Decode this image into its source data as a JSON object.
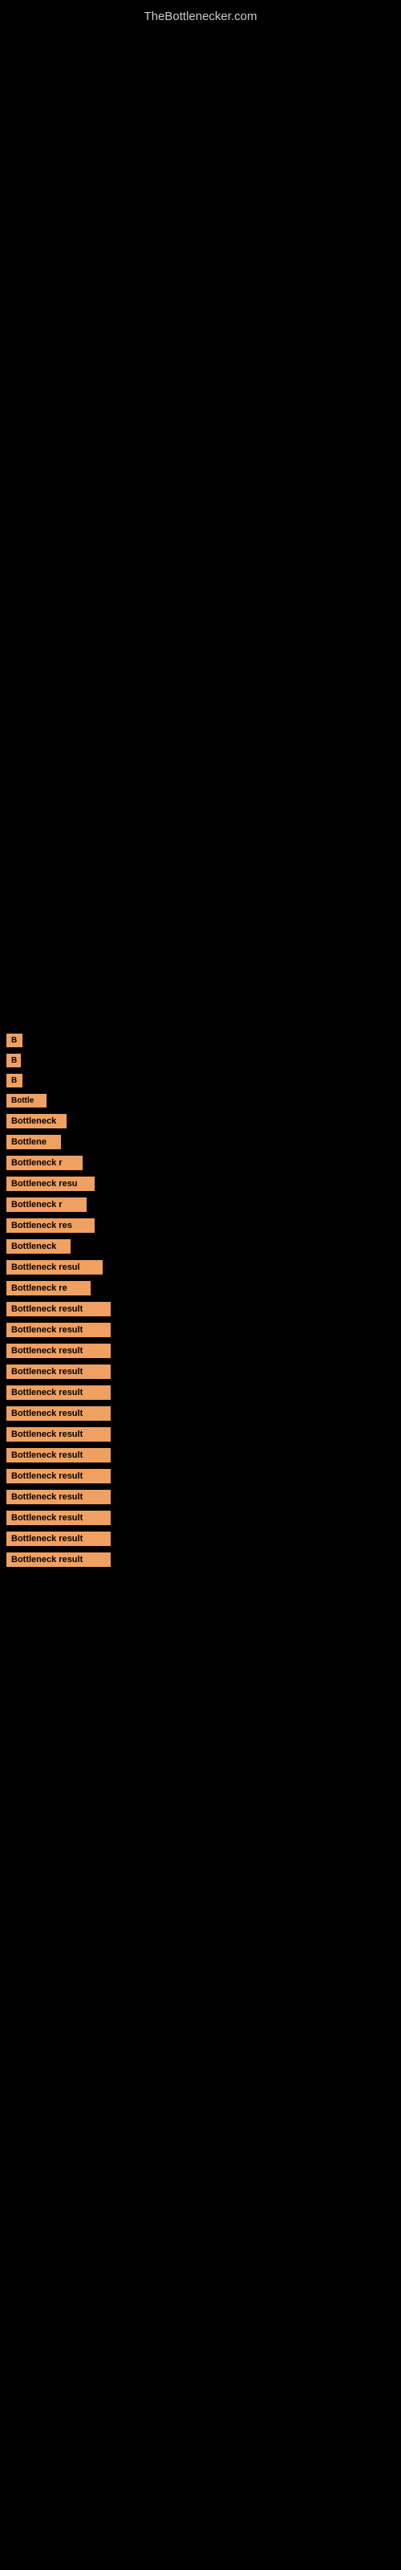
{
  "site": {
    "title": "TheBottlenecker.com"
  },
  "results": [
    {
      "id": 1,
      "label": "B",
      "full_text": "B"
    },
    {
      "id": 2,
      "label": "B",
      "full_text": "B"
    },
    {
      "id": 3,
      "label": "B",
      "full_text": "B"
    },
    {
      "id": 4,
      "label": "Bottle",
      "full_text": "Bottle"
    },
    {
      "id": 5,
      "label": "Bottleneck",
      "full_text": "Bottleneck"
    },
    {
      "id": 6,
      "label": "Bottlene",
      "full_text": "Bottlene"
    },
    {
      "id": 7,
      "label": "Bottleneck r",
      "full_text": "Bottleneck r"
    },
    {
      "id": 8,
      "label": "Bottleneck resu",
      "full_text": "Bottleneck resu"
    },
    {
      "id": 9,
      "label": "Bottleneck r",
      "full_text": "Bottleneck r"
    },
    {
      "id": 10,
      "label": "Bottleneck res",
      "full_text": "Bottleneck res"
    },
    {
      "id": 11,
      "label": "Bottleneck",
      "full_text": "Bottleneck"
    },
    {
      "id": 12,
      "label": "Bottleneck resul",
      "full_text": "Bottleneck resul"
    },
    {
      "id": 13,
      "label": "Bottleneck re",
      "full_text": "Bottleneck re"
    },
    {
      "id": 14,
      "label": "Bottleneck result",
      "full_text": "Bottleneck result"
    },
    {
      "id": 15,
      "label": "Bottleneck result",
      "full_text": "Bottleneck result"
    },
    {
      "id": 16,
      "label": "Bottleneck result",
      "full_text": "Bottleneck result"
    },
    {
      "id": 17,
      "label": "Bottleneck result",
      "full_text": "Bottleneck result"
    },
    {
      "id": 18,
      "label": "Bottleneck result",
      "full_text": "Bottleneck result"
    },
    {
      "id": 19,
      "label": "Bottleneck result",
      "full_text": "Bottleneck result"
    },
    {
      "id": 20,
      "label": "Bottleneck result",
      "full_text": "Bottleneck result"
    },
    {
      "id": 21,
      "label": "Bottleneck result",
      "full_text": "Bottleneck result"
    },
    {
      "id": 22,
      "label": "Bottleneck result",
      "full_text": "Bottleneck result"
    },
    {
      "id": 23,
      "label": "Bottleneck result",
      "full_text": "Bottleneck result"
    },
    {
      "id": 24,
      "label": "Bottleneck result",
      "full_text": "Bottleneck result"
    },
    {
      "id": 25,
      "label": "Bottleneck result",
      "full_text": "Bottleneck result"
    },
    {
      "id": 26,
      "label": "Bottleneck result",
      "full_text": "Bottleneck result"
    }
  ]
}
